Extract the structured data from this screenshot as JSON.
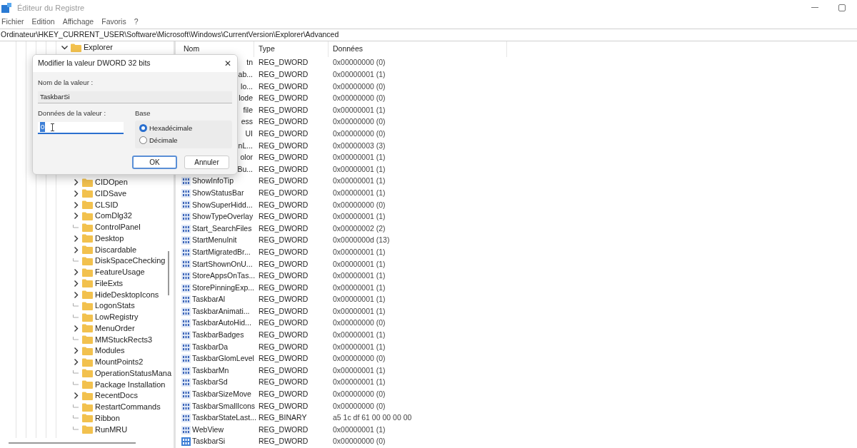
{
  "window": {
    "title": "Éditeur du Registre"
  },
  "menu": [
    "Fichier",
    "Edition",
    "Affichage",
    "Favoris",
    "?"
  ],
  "address": "Ordinateur\\HKEY_CURRENT_USER\\Software\\Microsoft\\Windows\\CurrentVersion\\Explorer\\Advanced",
  "tree": [
    {
      "label": "Explorer",
      "expanded": true,
      "children": [
        {
          "label": "CIDOpen",
          "expanded": false
        },
        {
          "label": "CIDSave",
          "expanded": false
        },
        {
          "label": "CLSID",
          "expanded": false
        },
        {
          "label": "ComDlg32",
          "expanded": false
        },
        {
          "label": "ControlPanel"
        },
        {
          "label": "Desktop",
          "expanded": false
        },
        {
          "label": "Discardable",
          "expanded": false
        },
        {
          "label": "DiskSpaceChecking"
        },
        {
          "label": "FeatureUsage",
          "expanded": false
        },
        {
          "label": "FileExts",
          "expanded": false
        },
        {
          "label": "HideDesktopIcons",
          "expanded": false
        },
        {
          "label": "LogonStats"
        },
        {
          "label": "LowRegistry"
        },
        {
          "label": "MenuOrder",
          "expanded": false
        },
        {
          "label": "MMStuckRects3"
        },
        {
          "label": "Modules",
          "expanded": false
        },
        {
          "label": "MountPoints2",
          "expanded": false
        },
        {
          "label": "OperationStatusMana"
        },
        {
          "label": "Package Installation"
        },
        {
          "label": "RecentDocs",
          "expanded": false
        },
        {
          "label": "RestartCommands"
        },
        {
          "label": "Ribbon"
        },
        {
          "label": "RunMRU"
        }
      ]
    }
  ],
  "table": {
    "columns": [
      "Nom",
      "Type",
      "Données"
    ],
    "rows": [
      {
        "kind": "cut",
        "name": "tn",
        "type": "REG_DWORD",
        "data": "0x00000000 (0)",
        "selected": false
      },
      {
        "kind": "cut",
        "name": "ab...",
        "type": "REG_DWORD",
        "data": "0x00000001 (1)",
        "selected": false
      },
      {
        "kind": "cut",
        "name": "lo...",
        "type": "REG_DWORD",
        "data": "0x00000000 (0)",
        "selected": false
      },
      {
        "kind": "cut",
        "name": "lode",
        "type": "REG_DWORD",
        "data": "0x00000000 (0)",
        "selected": false
      },
      {
        "kind": "cut",
        "name": "file",
        "type": "REG_DWORD",
        "data": "0x00000001 (1)",
        "selected": false
      },
      {
        "kind": "cut",
        "name": "ess",
        "type": "REG_DWORD",
        "data": "0x00000000 (0)",
        "selected": false
      },
      {
        "kind": "cut",
        "name": "UI",
        "type": "REG_DWORD",
        "data": "0x00000000 (0)",
        "selected": false
      },
      {
        "kind": "cut",
        "name": "nL...",
        "type": "REG_DWORD",
        "data": "0x00000003 (3)",
        "selected": false
      },
      {
        "kind": "cut",
        "name": "olor",
        "type": "REG_DWORD",
        "data": "0x00000001 (1)",
        "selected": false
      },
      {
        "kind": "cut",
        "name": "Bu...",
        "type": "REG_DWORD",
        "data": "0x00000001 (1)",
        "selected": false
      },
      {
        "kind": "full",
        "name": "ShowInfoTip",
        "type": "REG_DWORD",
        "data": "0x00000001 (1)",
        "selected": false
      },
      {
        "kind": "full",
        "name": "ShowStatusBar",
        "type": "REG_DWORD",
        "data": "0x00000001 (1)",
        "selected": false
      },
      {
        "kind": "full",
        "name": "ShowSuperHidd...",
        "type": "REG_DWORD",
        "data": "0x00000000 (0)",
        "selected": false
      },
      {
        "kind": "full",
        "name": "ShowTypeOverlay",
        "type": "REG_DWORD",
        "data": "0x00000001 (1)",
        "selected": false
      },
      {
        "kind": "full",
        "name": "Start_SearchFiles",
        "type": "REG_DWORD",
        "data": "0x00000002 (2)",
        "selected": false
      },
      {
        "kind": "full",
        "name": "StartMenuInit",
        "type": "REG_DWORD",
        "data": "0x0000000d (13)",
        "selected": false
      },
      {
        "kind": "full",
        "name": "StartMigratedBr...",
        "type": "REG_DWORD",
        "data": "0x00000001 (1)",
        "selected": false
      },
      {
        "kind": "full",
        "name": "StartShownOnU...",
        "type": "REG_DWORD",
        "data": "0x00000001 (1)",
        "selected": false
      },
      {
        "kind": "full",
        "name": "StoreAppsOnTas...",
        "type": "REG_DWORD",
        "data": "0x00000001 (1)",
        "selected": false
      },
      {
        "kind": "full",
        "name": "StorePinningExp...",
        "type": "REG_DWORD",
        "data": "0x00000001 (1)",
        "selected": false
      },
      {
        "kind": "full",
        "name": "TaskbarAl",
        "type": "REG_DWORD",
        "data": "0x00000001 (1)",
        "selected": false
      },
      {
        "kind": "full",
        "name": "TaskbarAnimati...",
        "type": "REG_DWORD",
        "data": "0x00000001 (1)",
        "selected": false
      },
      {
        "kind": "full",
        "name": "TaskbarAutoHid...",
        "type": "REG_DWORD",
        "data": "0x00000000 (0)",
        "selected": false
      },
      {
        "kind": "full",
        "name": "TaskbarBadges",
        "type": "REG_DWORD",
        "data": "0x00000001 (1)",
        "selected": false
      },
      {
        "kind": "full",
        "name": "TaskbarDa",
        "type": "REG_DWORD",
        "data": "0x00000001 (1)",
        "selected": false
      },
      {
        "kind": "full",
        "name": "TaskbarGlomLevel",
        "type": "REG_DWORD",
        "data": "0x00000000 (0)",
        "selected": false
      },
      {
        "kind": "full",
        "name": "TaskbarMn",
        "type": "REG_DWORD",
        "data": "0x00000001 (1)",
        "selected": false
      },
      {
        "kind": "full",
        "name": "TaskbarSd",
        "type": "REG_DWORD",
        "data": "0x00000001 (1)",
        "selected": false
      },
      {
        "kind": "full",
        "name": "TaskbarSizeMove",
        "type": "REG_DWORD",
        "data": "0x00000000 (0)",
        "selected": false
      },
      {
        "kind": "full",
        "name": "TaskbarSmallIcons",
        "type": "REG_DWORD",
        "data": "0x00000000 (0)",
        "selected": false
      },
      {
        "kind": "full",
        "name": "TaskbarStateLast...",
        "type": "REG_BINARY",
        "data": "a5 1c df 61 00 00 00 00",
        "selected": false
      },
      {
        "kind": "full",
        "name": "WebView",
        "type": "REG_DWORD",
        "data": "0x00000001 (1)",
        "selected": false
      },
      {
        "kind": "full",
        "name": "TaskbarSi",
        "type": "REG_DWORD",
        "data": "0x00000000 (0)",
        "selected": true
      }
    ]
  },
  "dialog": {
    "title": "Modifier la valeur DWORD 32 bits",
    "close": "✕",
    "name_label": "Nom de la valeur :",
    "name_value": "TaskbarSi",
    "data_label": "Données de la valeur :",
    "data_value": "0",
    "base": {
      "title": "Base",
      "options": [
        {
          "label": "Hexadécimale",
          "selected": true
        },
        {
          "label": "Décimale",
          "selected": false
        }
      ]
    },
    "buttons": [
      {
        "label": "OK",
        "focused": true
      },
      {
        "label": "Annuler",
        "focused": false
      }
    ]
  }
}
